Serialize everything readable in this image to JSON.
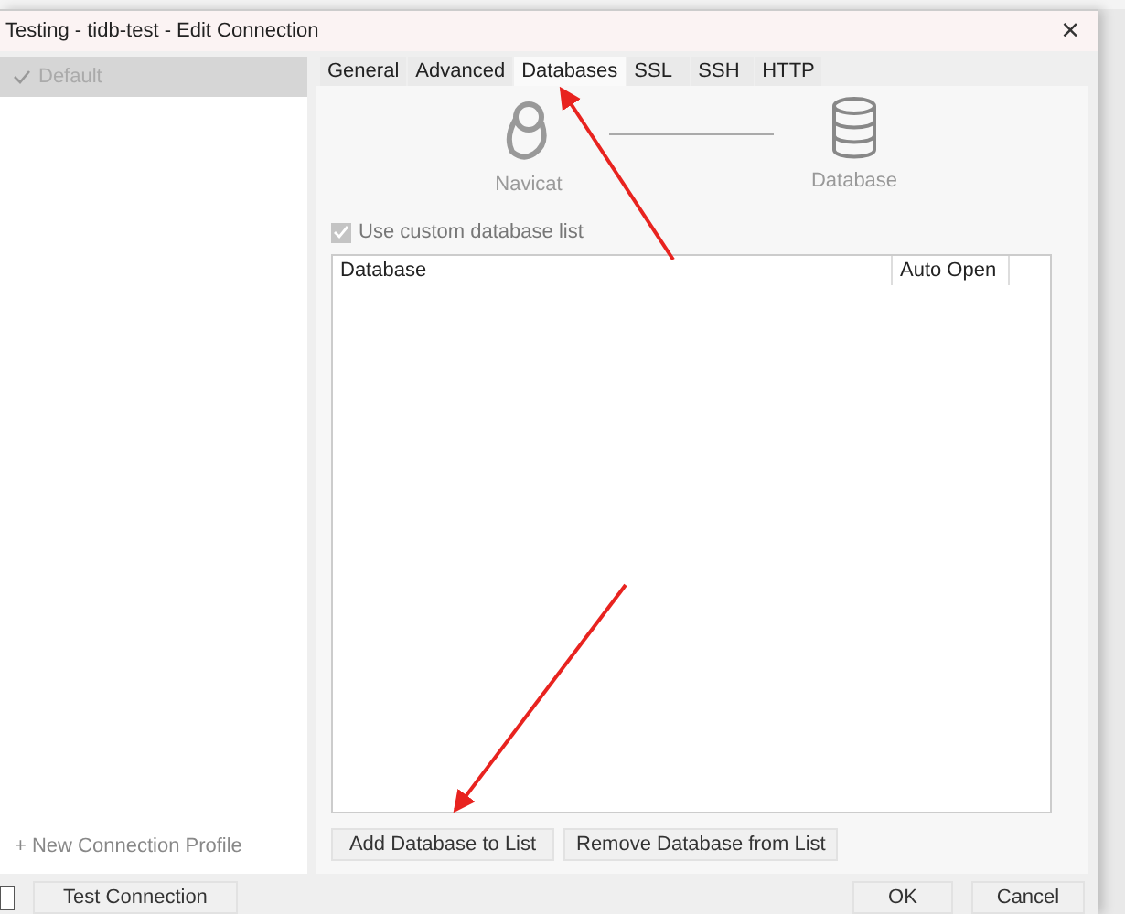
{
  "window": {
    "title": "Testing - tidb-test - Edit Connection",
    "close": "×"
  },
  "sidebar": {
    "items": [
      {
        "label": "Default",
        "selected": true
      }
    ],
    "add_link": "+ New Connection Profile"
  },
  "tabs": [
    {
      "label": "General",
      "selected": false
    },
    {
      "label": "Advanced",
      "selected": false
    },
    {
      "label": "Databases",
      "selected": true
    },
    {
      "label": "SSL",
      "selected": false
    },
    {
      "label": "SSH",
      "selected": false
    },
    {
      "label": "HTTP",
      "selected": false
    }
  ],
  "diagram": {
    "left": "Navicat",
    "right": "Database"
  },
  "custom_list": {
    "label": "Use custom database list",
    "checked": true,
    "disabled": true
  },
  "table": {
    "columns": [
      "Database",
      "Auto Open"
    ]
  },
  "list_buttons": [
    "Add Database to List",
    "Remove Database from List"
  ],
  "footer": {
    "test": "Test Connection",
    "ok": "OK",
    "cancel": "Cancel"
  },
  "annotations": [
    {
      "kind": "arrow"
    },
    {
      "kind": "arrow"
    }
  ]
}
